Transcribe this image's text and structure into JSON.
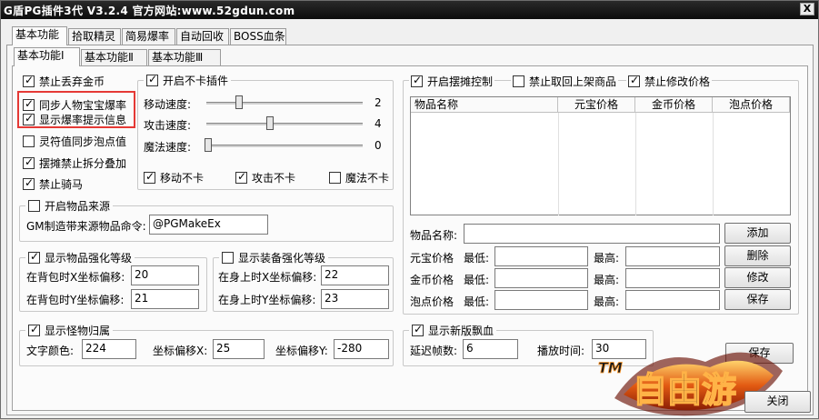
{
  "window": {
    "title": "G盾PG插件3代 V3.2.4   官方网站:www.52gdun.com",
    "close_glyph": "X"
  },
  "main_tabs": [
    "基本功能",
    "拾取精灵",
    "简易爆率",
    "自动回收",
    "BOSS血条"
  ],
  "sub_tabs": [
    "基本功能Ⅰ",
    "基本功能Ⅱ",
    "基本功能Ⅲ"
  ],
  "left_options": [
    {
      "label": "禁止丢弃金币",
      "checked": true
    },
    {
      "label": "同步人物宝宝爆率",
      "checked": true
    },
    {
      "label": "显示爆率提示信息",
      "checked": true
    },
    {
      "label": "灵符值同步泡点值",
      "checked": false
    },
    {
      "label": "摆摊禁止拆分叠加",
      "checked": true
    },
    {
      "label": "禁止骑马",
      "checked": true
    }
  ],
  "speed": {
    "title": "开启不卡插件",
    "checked": true,
    "sliders": [
      {
        "label": "移动速度:",
        "value": "2",
        "fraction": 0.2
      },
      {
        "label": "攻击速度:",
        "value": "4",
        "fraction": 0.4
      },
      {
        "label": "魔法速度:",
        "value": "0",
        "fraction": 0.0
      }
    ],
    "checks": [
      {
        "label": "移动不卡",
        "checked": true
      },
      {
        "label": "攻击不卡",
        "checked": true
      },
      {
        "label": "魔法不卡",
        "checked": false
      }
    ]
  },
  "item_source": {
    "title": "开启物品来源",
    "checked": false,
    "command_label": "GM制造带来源物品命令:",
    "command_value": "@PGMakeEx"
  },
  "item_strength": {
    "title": "显示物品强化等级",
    "checked": true,
    "x_label": "在背包时X坐标偏移:",
    "x_value": "20",
    "y_label": "在背包时Y坐标偏移:",
    "y_value": "21"
  },
  "equip_strength": {
    "title": "显示装备强化等级",
    "checked": false,
    "x_label": "在身上时X坐标偏移:",
    "x_value": "22",
    "y_label": "在身上时Y坐标偏移:",
    "y_value": "23"
  },
  "monster_owner": {
    "title": "显示怪物归属",
    "checked": true,
    "color_label": "文字颜色:",
    "color_value": "224",
    "x_label": "坐标偏移X:",
    "x_value": "25",
    "y_label": "坐标偏移Y:",
    "y_value": "-280"
  },
  "stall": {
    "checks": [
      {
        "label": "开启摆摊控制",
        "checked": true
      },
      {
        "label": "禁止取回上架商品",
        "checked": false
      },
      {
        "label": "禁止修改价格",
        "checked": true
      }
    ],
    "columns": [
      "物品名称",
      "元宝价格",
      "金币价格",
      "泡点价格"
    ],
    "name_label": "物品名称:",
    "name_value": "",
    "rows": [
      {
        "label": "元宝价格",
        "min_label": "最低:",
        "min_value": "",
        "max_label": "最高:",
        "max_value": ""
      },
      {
        "label": "金币价格",
        "min_label": "最低:",
        "min_value": "",
        "max_label": "最高:",
        "max_value": ""
      },
      {
        "label": "泡点价格",
        "min_label": "最低:",
        "min_value": "",
        "max_label": "最高:",
        "max_value": ""
      }
    ],
    "buttons": [
      "添加",
      "删除",
      "修改",
      "保存"
    ]
  },
  "floating_blood": {
    "title": "显示新版飘血",
    "checked": true,
    "delay_label": "延迟帧数:",
    "delay_value": "6",
    "play_label": "播放时间:",
    "play_value": "30"
  },
  "footer": {
    "save_label": "保存",
    "close_label": "关闭",
    "logo_text": "TM 自由游"
  },
  "colors": {
    "highlight_border": "#e53935",
    "logo_fire": "#e25a12"
  }
}
